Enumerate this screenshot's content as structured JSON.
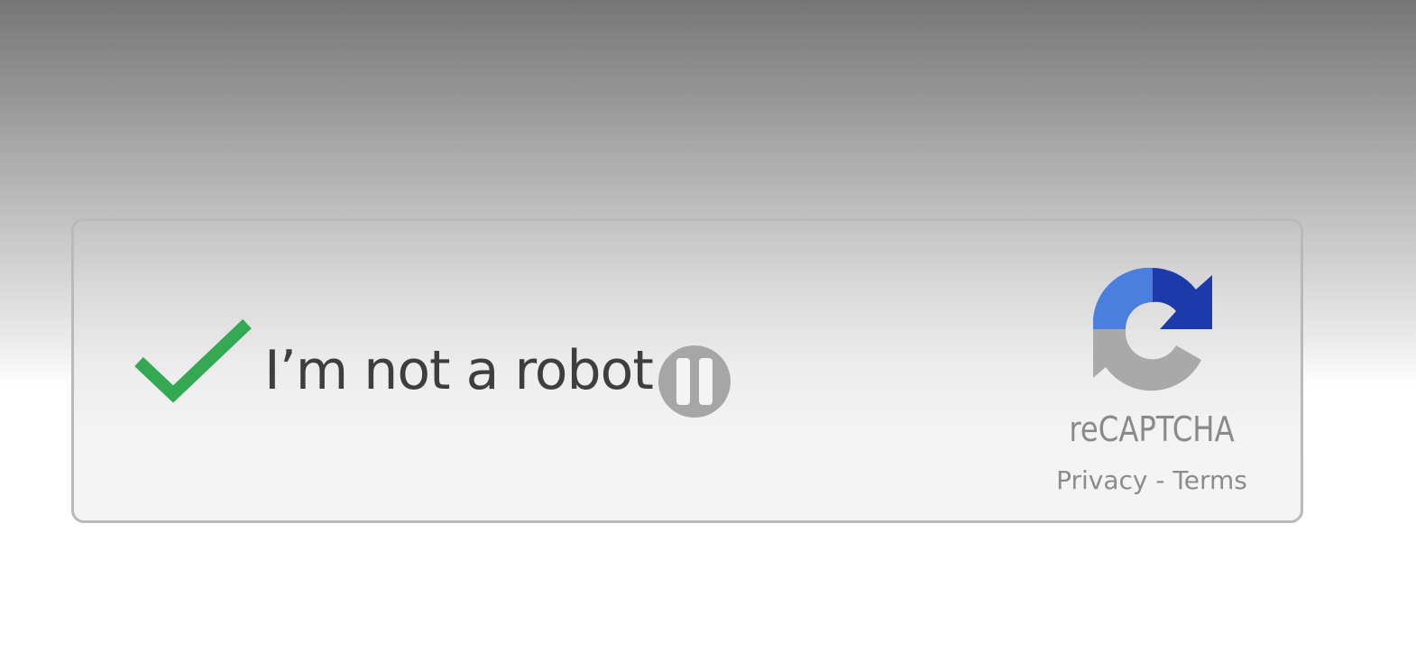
{
  "widget": {
    "label": "I’m not a robot",
    "checked": true,
    "check_color": "#34a853",
    "brand": "reCAPTCHA",
    "privacy_label": "Privacy",
    "separator": " - ",
    "terms_label": "Terms"
  },
  "media": {
    "state": "paused"
  },
  "colors": {
    "logo_blue_light": "#4a7fde",
    "logo_blue_dark": "#1c3aa9",
    "logo_gray": "#a9a9a9",
    "text": "#3e3e3e",
    "muted_text": "#8a8a8a"
  }
}
